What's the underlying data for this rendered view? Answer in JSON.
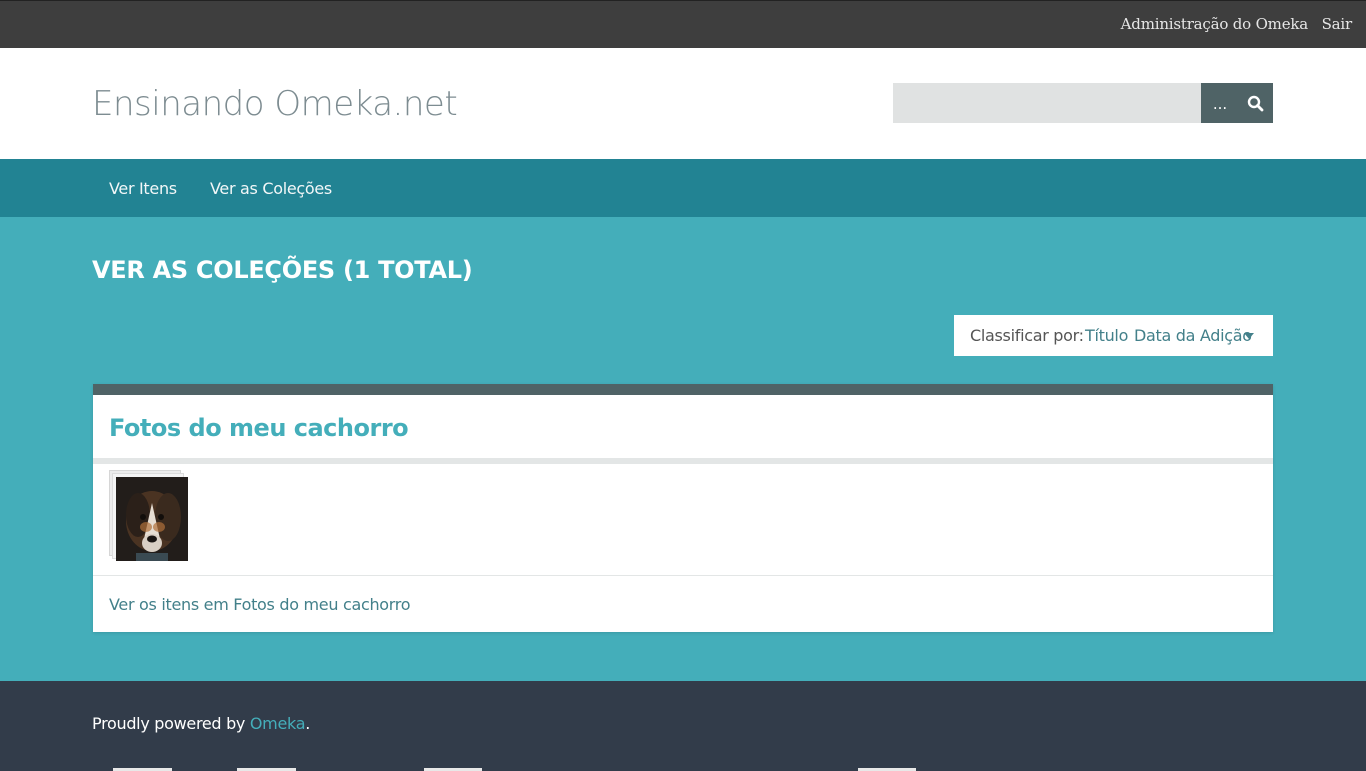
{
  "admin_bar": {
    "admin_label": "Administração do Omeka",
    "logout_label": "Sair"
  },
  "header": {
    "site_title": "Ensinando Omeka.net",
    "search": {
      "placeholder": "",
      "options_label": "...",
      "submit_icon": "search-icon"
    }
  },
  "nav": {
    "items": [
      {
        "label": "Ver Itens"
      },
      {
        "label": "Ver as Coleções"
      }
    ]
  },
  "main": {
    "page_title": "VER AS COLEÇÕES (1 TOTAL)",
    "sort": {
      "label": "Classificar por:",
      "options": [
        "Título",
        "Data da Adição"
      ],
      "active_icon": "caret-down-icon"
    },
    "collections": [
      {
        "title": "Fotos do meu cachorro",
        "thumbnail": "dog-photo",
        "link_label": "Ver os itens em Fotos do meu cachorro"
      }
    ]
  },
  "footer": {
    "prefix": "Proudly powered by ",
    "link": "Omeka",
    "suffix": "."
  },
  "colors": {
    "admin_bar": "#3e3e3e",
    "nav": "#228393",
    "page_bg": "#44aeba",
    "accent": "#44aeba",
    "link": "#43808a",
    "footer": "#323c4a"
  }
}
